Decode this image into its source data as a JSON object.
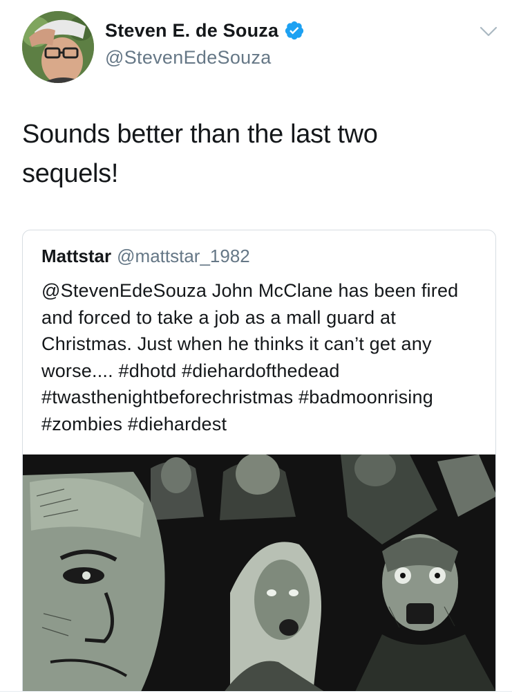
{
  "author": {
    "name": "Steven E. de Souza",
    "handle": "@StevenEdeSouza",
    "avatar_icon": "avatar-photo",
    "verified_icon": "verified-badge-icon",
    "verified_color": "#1da1f2"
  },
  "menu": {
    "icon": "chevron-down-icon"
  },
  "tweet": {
    "text": "Sounds better than the last two sequels!"
  },
  "quoted_tweet": {
    "name": "Mattstar",
    "handle": "@mattstar_1982",
    "text": "@StevenEdeSouza John McClane has been fired and forced to take a job as a mall guard at Christmas. Just when he thinks it can’t get any worse....  #dhotd #diehardofthedead #twasthenightbeforechristmas #badmoonrising #zombies #diehardest",
    "media_icon": "comic-zombie-artwork-image"
  },
  "colors": {
    "text_primary": "#14171a",
    "text_secondary": "#657786",
    "border": "#d7dde2"
  }
}
